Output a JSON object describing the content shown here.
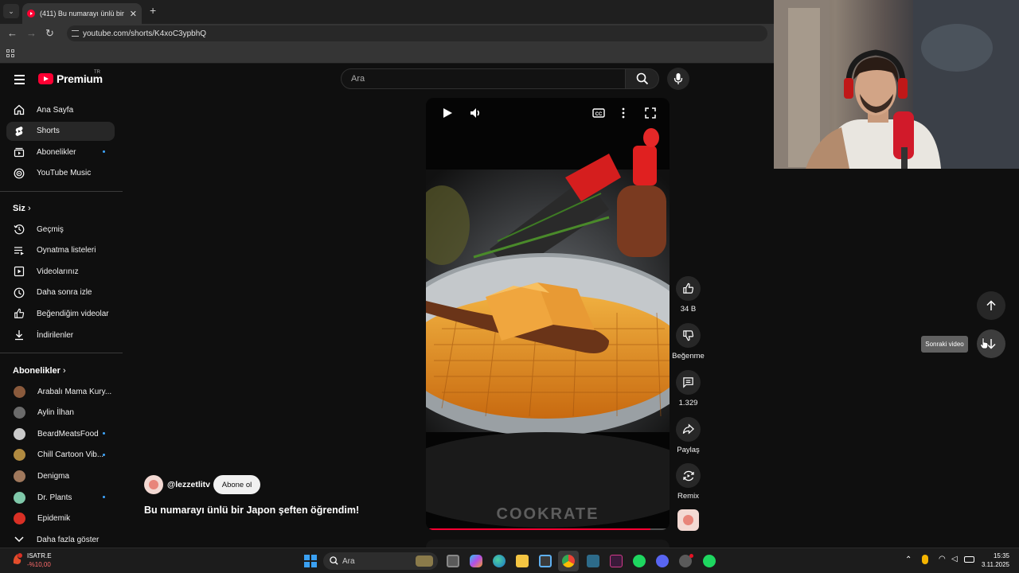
{
  "browser": {
    "tab_title": "(411) Bu numarayı ünlü bir Japo",
    "url": "youtube.com/shorts/K4xoC3ypbhQ"
  },
  "header": {
    "logo_text": "Premium",
    "logo_region": "TR",
    "search_placeholder": "Ara"
  },
  "sidebar": {
    "main_items": [
      {
        "label": "Ana Sayfa",
        "icon": "home-icon"
      },
      {
        "label": "Shorts",
        "icon": "shorts-icon",
        "active": true
      },
      {
        "label": "Abonelikler",
        "icon": "subscriptions-icon",
        "dot": true
      },
      {
        "label": "YouTube Music",
        "icon": "music-icon"
      }
    ],
    "you_heading": "Siz",
    "you_items": [
      {
        "label": "Geçmiş",
        "icon": "history-icon"
      },
      {
        "label": "Oynatma listeleri",
        "icon": "playlists-icon"
      },
      {
        "label": "Videolarınız",
        "icon": "your-videos-icon"
      },
      {
        "label": "Daha sonra izle",
        "icon": "watch-later-icon"
      },
      {
        "label": "Beğendiğim videolar",
        "icon": "liked-icon"
      },
      {
        "label": "İndirilenler",
        "icon": "downloads-icon"
      }
    ],
    "subs_heading": "Abonelikler",
    "subscriptions": [
      {
        "label": "Arabalı Mama Kury...",
        "color": "#8a5a3c",
        "dot": false
      },
      {
        "label": "Aylin İlhan",
        "color": "#6b6b6b",
        "dot": false
      },
      {
        "label": "BeardMeatsFood",
        "color": "#c9c9c9",
        "dot": true
      },
      {
        "label": "Chill Cartoon Vib...",
        "color": "#b08a40",
        "dot": true
      },
      {
        "label": "Denigma",
        "color": "#a0785c",
        "dot": false
      },
      {
        "label": "Dr. Plants",
        "color": "#7fc8a9",
        "dot": true
      },
      {
        "label": "Epidemik",
        "color": "#d93025",
        "dot": false
      }
    ],
    "show_more": "Daha fazla göster"
  },
  "video": {
    "watermark": "COOKRATE",
    "progress": 0.92,
    "channel": "@lezzetlitv",
    "subscribe": "Abone ol",
    "title": "Bu numarayı ünlü bir Japon şeften öğrendim!"
  },
  "actions": {
    "likes": "34 B",
    "dislike": "Beğenme",
    "comments": "1.329",
    "share": "Paylaş",
    "remix": "Remix"
  },
  "navigation": {
    "next_tooltip": "Sonraki video"
  },
  "taskbar": {
    "stock_name": "ISATR.E",
    "stock_change": "-%10,00",
    "search_label": "Ara",
    "time": "15:35",
    "date": "3.11.2025"
  },
  "colors": {
    "accent": "#ff0033",
    "background": "#0f0f0f",
    "surface": "#272727",
    "link_dot": "#3ea6ff"
  }
}
